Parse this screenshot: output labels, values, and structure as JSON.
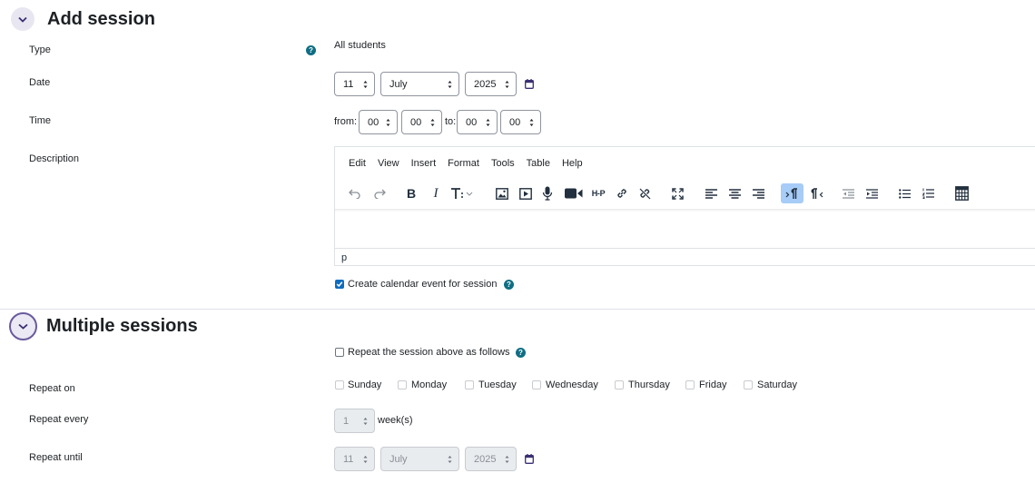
{
  "add_session": {
    "title": "Add session",
    "type": {
      "label": "Type",
      "value": "All students"
    },
    "date": {
      "label": "Date",
      "day": "11",
      "month": "July",
      "year": "2025"
    },
    "time": {
      "label": "Time",
      "from_label": "from:",
      "from_hour": "00",
      "from_min": "00",
      "to_label": "to:",
      "to_hour": "00",
      "to_min": "00"
    },
    "description": {
      "label": "Description",
      "menu": [
        "Edit",
        "View",
        "Insert",
        "Format",
        "Tools",
        "Table",
        "Help"
      ],
      "status_path": "p"
    },
    "calendar_event": {
      "label": "Create calendar event for session",
      "checked": true
    }
  },
  "multiple_sessions": {
    "title": "Multiple sessions",
    "repeat_toggle": {
      "label": "Repeat the session above as follows",
      "checked": false
    },
    "repeat_on": {
      "label": "Repeat on",
      "days": [
        "Sunday",
        "Monday",
        "Tuesday",
        "Wednesday",
        "Thursday",
        "Friday",
        "Saturday"
      ]
    },
    "repeat_every": {
      "label": "Repeat every",
      "value": "1",
      "unit": "week(s)"
    },
    "repeat_until": {
      "label": "Repeat until",
      "day": "11",
      "month": "July",
      "year": "2025"
    }
  },
  "colors": {
    "accent": "#0f6cbf",
    "help": "#0f6e84",
    "toolbar_active": "#a6ccf7",
    "calendar_icon": "#3a2f73"
  },
  "icons": [
    "chevron-down-icon",
    "help-icon",
    "calendar-icon",
    "undo-icon",
    "redo-icon",
    "bold-icon",
    "italic-icon",
    "text-size-icon",
    "image-icon",
    "media-icon",
    "microphone-icon",
    "video-icon",
    "h5p-icon",
    "link-icon",
    "unlink-icon",
    "fullscreen-icon",
    "align-left-icon",
    "align-center-icon",
    "align-right-icon",
    "ltr-icon",
    "rtl-icon",
    "outdent-icon",
    "indent-icon",
    "bullet-list-icon",
    "numbered-list-icon",
    "calculator-icon"
  ]
}
